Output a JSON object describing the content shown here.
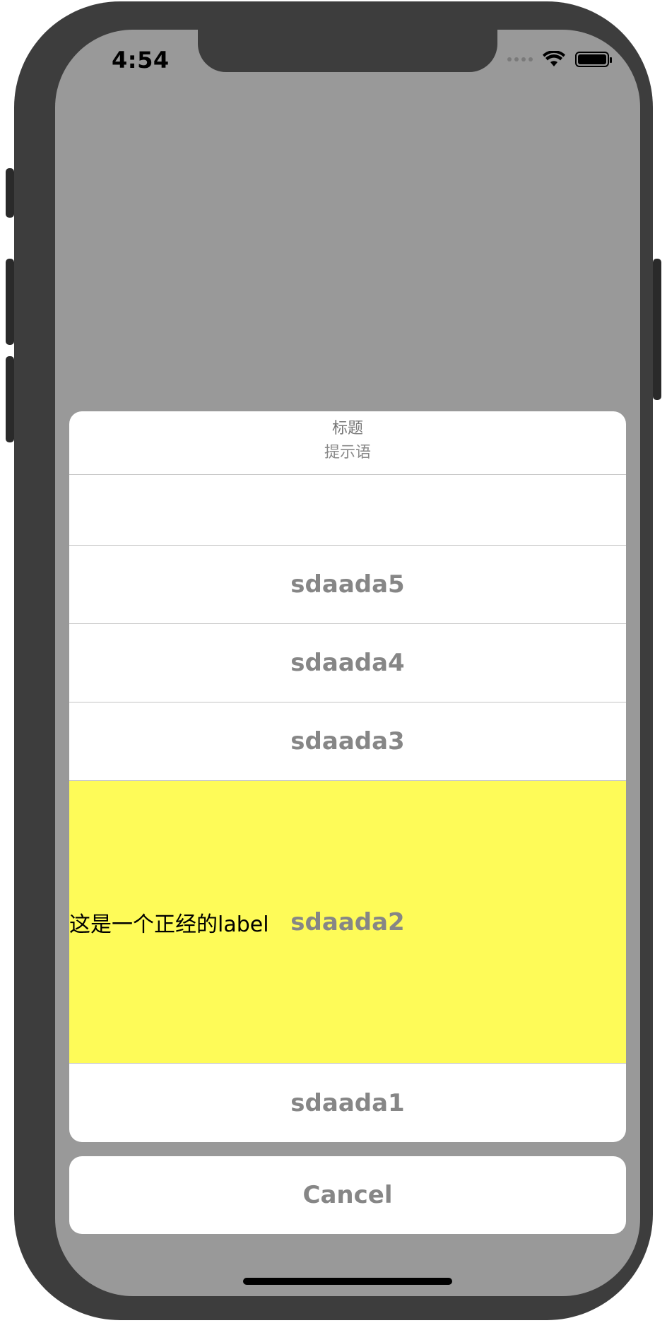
{
  "status_bar": {
    "time": "4:54",
    "icons": [
      "cellular-dots-icon",
      "wifi-icon",
      "battery-icon"
    ]
  },
  "action_sheet": {
    "title": "标题",
    "message": "提示语",
    "items": [
      "sdaada5",
      "sdaada4",
      "sdaada3",
      "sdaada2",
      "sdaada1"
    ],
    "custom_label": "这是一个正经的label",
    "cancel": "Cancel"
  },
  "colors": {
    "dim_background": "#999999",
    "highlight_row": "#fefb58",
    "button_text": "#868686"
  }
}
